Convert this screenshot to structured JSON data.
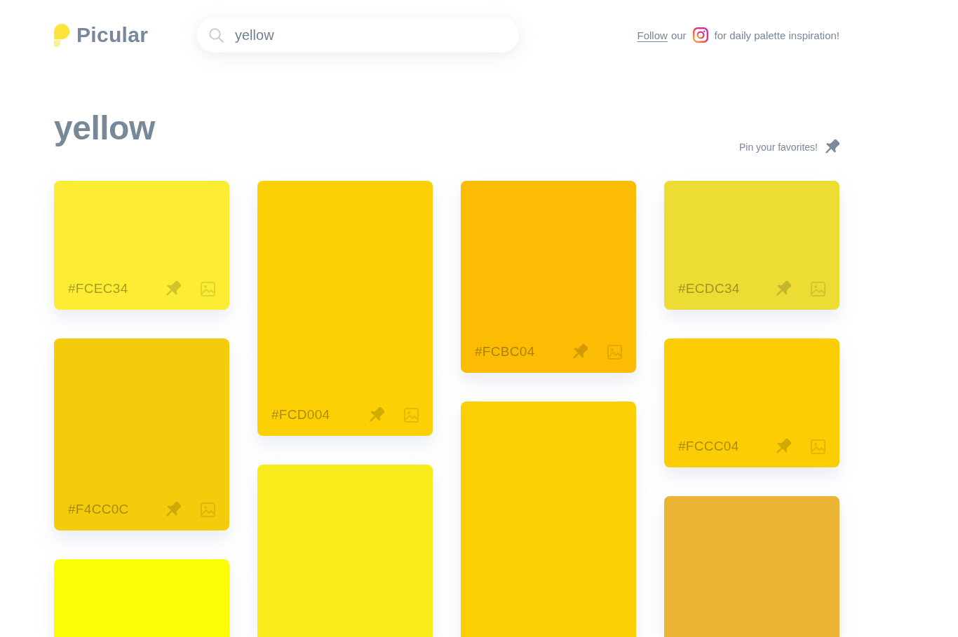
{
  "header": {
    "logo": {
      "name": "Picular"
    },
    "search": {
      "value": "yellow"
    },
    "promo": {
      "link": "Follow",
      "text_before_icon": "our",
      "text_after_icon": "for daily palette inspiration!"
    }
  },
  "results": {
    "title": "yellow",
    "pin_hint": "Pin your favorites!"
  },
  "columns": [
    {
      "cards": [
        {
          "hex": "#FCEC34",
          "color": "#fcec34"
        },
        {
          "hex": "#F4CC0C",
          "color": "#f4cc0c"
        },
        {
          "color": "#fcfc04"
        }
      ]
    },
    {
      "cards": [
        {
          "hex": "#FCD004",
          "color": "#fcd004"
        },
        {
          "color": "#f8eb1c"
        }
      ]
    },
    {
      "cards": [
        {
          "hex": "#FCBC04",
          "color": "#fcbc04"
        },
        {
          "color": "#fcce04"
        }
      ]
    },
    {
      "cards": [
        {
          "hex": "#ECDC34",
          "color": "#ecdc34"
        },
        {
          "hex": "#FCCC04",
          "color": "#fccc04"
        },
        {
          "color": "#ecb434"
        }
      ]
    }
  ]
}
